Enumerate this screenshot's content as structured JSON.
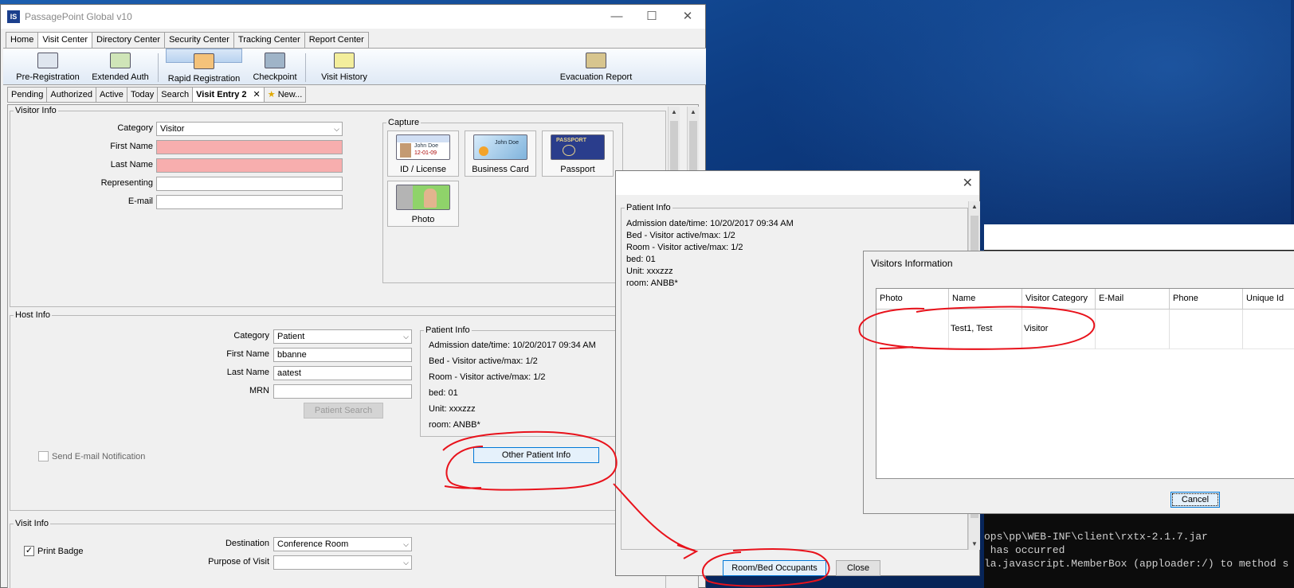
{
  "window": {
    "title": "PassagePoint Global v10",
    "icon_label": "IS"
  },
  "menu_tabs": [
    "Home",
    "Visit Center",
    "Directory Center",
    "Security Center",
    "Tracking Center",
    "Report Center"
  ],
  "ribbon": {
    "pre_registration": "Pre-Registration",
    "extended_auth": "Extended Auth",
    "rapid_registration": "Rapid Registration",
    "checkpoint": "Checkpoint",
    "visit_history": "Visit History",
    "evacuation_report": "Evacuation Report"
  },
  "sub_tabs": {
    "pending": "Pending",
    "authorized": "Authorized",
    "active": "Active",
    "today": "Today",
    "search": "Search",
    "visit_entry": "Visit Entry 2",
    "new": "New..."
  },
  "visitor_info": {
    "legend": "Visitor Info",
    "category_label": "Category",
    "category_value": "Visitor",
    "first_name_label": "First Name",
    "first_name_value": "",
    "last_name_label": "Last Name",
    "last_name_value": "",
    "representing_label": "Representing",
    "representing_value": "",
    "email_label": "E-mail",
    "email_value": ""
  },
  "capture": {
    "legend": "Capture",
    "id_license": "ID / License",
    "business_card": "Business Card",
    "passport": "Passport",
    "photo": "Photo",
    "id_card_name": "John Doe",
    "id_card_date": "12-01-09",
    "biz_card_name": "John Doe",
    "passport_text": "PASSPORT"
  },
  "host_info": {
    "legend": "Host Info",
    "category_label": "Category",
    "category_value": "Patient",
    "first_name_label": "First Name",
    "first_name_value": "bbanne",
    "last_name_label": "Last Name",
    "last_name_value": "aatest",
    "mrn_label": "MRN",
    "mrn_value": "",
    "patient_search": "Patient Search",
    "send_email": "Send E-mail Notification",
    "other_patient_info": "Other Patient Info"
  },
  "patient_info": {
    "legend": "Patient Info",
    "admission": "Admission date/time: 10/20/2017 09:34 AM",
    "bed_visitor": "Bed - Visitor active/max: 1/2",
    "room_visitor": "Room - Visitor active/max: 1/2",
    "bed": "bed: 01",
    "unit": "Unit: xxxzzz",
    "room": "room: ANBB*"
  },
  "visit_info": {
    "legend": "Visit Info",
    "print_badge": "Print Badge",
    "destination_label": "Destination",
    "destination_value": "Conference Room",
    "purpose_label": "Purpose of Visit",
    "purpose_value": ""
  },
  "dialog_patient": {
    "legend": "Patient Info",
    "admission": "Admission date/time: 10/20/2017 09:34 AM",
    "bed_visitor": "Bed - Visitor active/max: 1/2",
    "room_visitor": "Room - Visitor active/max: 1/2",
    "bed": "bed: 01",
    "unit": "Unit: xxxzzz",
    "room": "room: ANBB*",
    "room_bed_occupants": "Room/Bed Occupants",
    "close": "Close"
  },
  "dialog_visitors": {
    "title": "Visitors Information",
    "columns": [
      "Photo",
      "Name",
      "Visitor Category",
      "E-Mail",
      "Phone",
      "Unique Id"
    ],
    "rows": [
      {
        "photo": "",
        "name": "Test1, Test",
        "category": "Visitor",
        "email": "",
        "phone": "",
        "unique_id": ""
      }
    ],
    "cancel": "Cancel"
  },
  "console": {
    "lines": [
      "ops\\pp\\WEB-INF\\client\\rxtx-2.1.7.jar",
      " has occurred",
      "la.javascript.MemberBox (apploader:/) to method s"
    ]
  },
  "colors": {
    "required_field": "#f7aeae",
    "annotation": "#e8121b",
    "ribbon_selected": "#b9d3f0"
  }
}
